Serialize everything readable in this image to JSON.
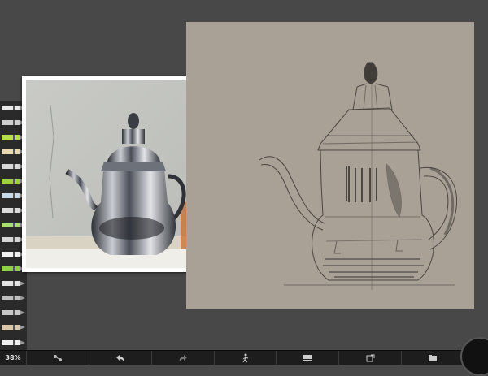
{
  "zoom_level": "38%",
  "tools": [
    {
      "name": "eraser-tool",
      "color": "#e8e8e8"
    },
    {
      "name": "airbrush-tool",
      "color": "#cfcfcf"
    },
    {
      "name": "marker-green-tool",
      "color": "#b8e04a"
    },
    {
      "name": "pencil-cream-tool",
      "color": "#e9d9b0"
    },
    {
      "name": "pen-tool",
      "color": "#d8d8d8"
    },
    {
      "name": "marker-lime-tool",
      "color": "#9fd23a"
    },
    {
      "name": "paint-tube-tool",
      "color": "#c7d8e6"
    },
    {
      "name": "brush-tool",
      "color": "#dcdcdc"
    },
    {
      "name": "marker-light-green-tool",
      "color": "#a7e070"
    },
    {
      "name": "pencil-tool",
      "color": "#d6d6d6"
    },
    {
      "name": "white-tube-tool",
      "color": "#f2f2f2"
    },
    {
      "name": "green-pot-tool",
      "color": "#8fcf4a"
    },
    {
      "name": "palette-knife-tool",
      "color": "#e3e3e3"
    },
    {
      "name": "spray-can-tool",
      "color": "#bdbdbd"
    },
    {
      "name": "fine-brush-tool",
      "color": "#c8c8c8"
    },
    {
      "name": "flat-brush-tool",
      "color": "#d9c7a8"
    },
    {
      "name": "smudge-tool",
      "color": "#efefef"
    }
  ],
  "toolbar_icons": [
    "transform-icon",
    "undo-icon",
    "redo-icon",
    "symmetry-icon",
    "layers-icon",
    "canvas-icon",
    "gallery-icon"
  ],
  "colors": {
    "canvas": "#a9a096",
    "rail": "#2a2a2a",
    "background": "#484848",
    "toolbar": "#1d1d1d",
    "current_color": "#111111"
  }
}
